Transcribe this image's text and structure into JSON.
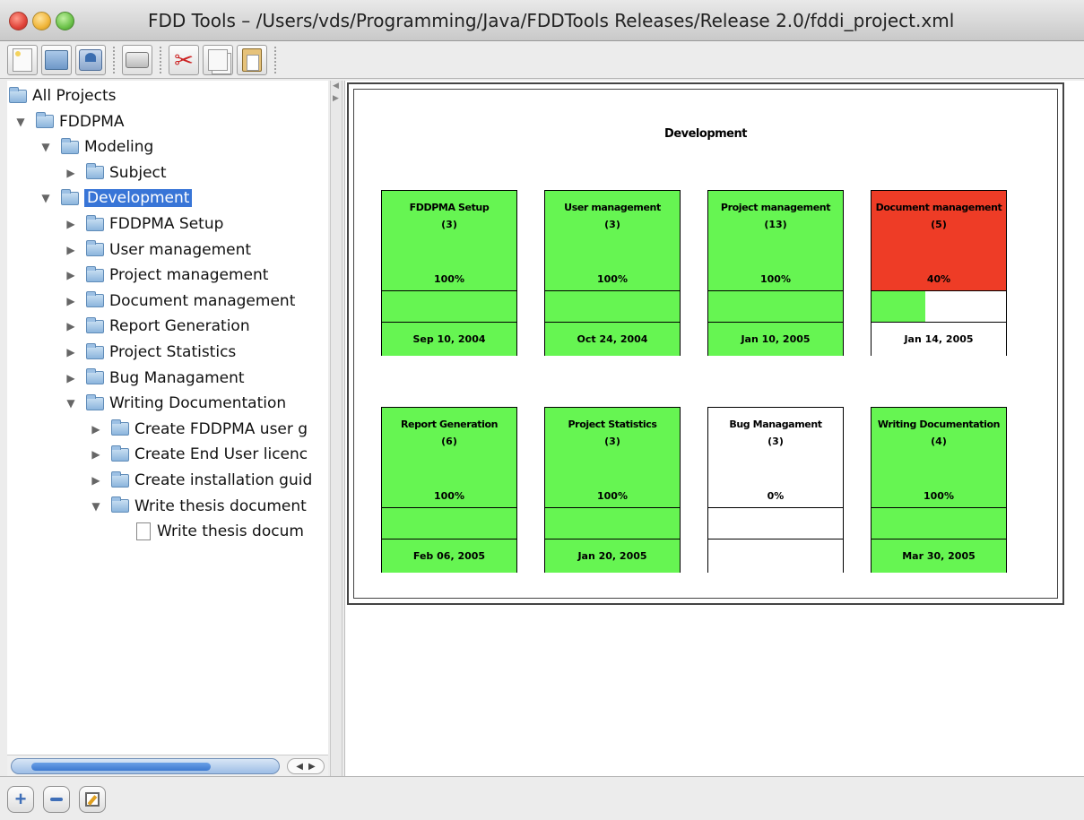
{
  "window": {
    "title": "FDD Tools – /Users/vds/Programming/Java/FDDTools Releases/Release 2.0/fddi_project.xml"
  },
  "toolbar": {
    "buttons": [
      "new-document-icon",
      "open-icon",
      "save-icon",
      "print-icon",
      "cut-icon",
      "copy-icon",
      "paste-icon"
    ]
  },
  "tree": {
    "items": [
      {
        "label": "All Projects",
        "depth": 0,
        "state": "none",
        "icon": "folder-icon"
      },
      {
        "label": "FDDPMA",
        "depth": 0,
        "state": "expanded",
        "icon": "folder-icon"
      },
      {
        "label": "Modeling",
        "depth": 1,
        "state": "expanded",
        "icon": "folder-icon"
      },
      {
        "label": "Subject",
        "depth": 2,
        "state": "collapsed",
        "icon": "folder-icon"
      },
      {
        "label": "Development",
        "depth": 1,
        "state": "expanded",
        "icon": "folder-icon",
        "selected": true
      },
      {
        "label": "FDDPMA Setup",
        "depth": 2,
        "state": "collapsed",
        "icon": "folder-icon"
      },
      {
        "label": "User management",
        "depth": 2,
        "state": "collapsed",
        "icon": "folder-icon"
      },
      {
        "label": "Project management",
        "depth": 2,
        "state": "collapsed",
        "icon": "folder-icon"
      },
      {
        "label": "Document management",
        "depth": 2,
        "state": "collapsed",
        "icon": "folder-icon"
      },
      {
        "label": "Report Generation",
        "depth": 2,
        "state": "collapsed",
        "icon": "folder-icon"
      },
      {
        "label": "Project Statistics",
        "depth": 2,
        "state": "collapsed",
        "icon": "folder-icon"
      },
      {
        "label": "Bug Managament",
        "depth": 2,
        "state": "collapsed",
        "icon": "folder-icon"
      },
      {
        "label": "Writing Documentation",
        "depth": 2,
        "state": "expanded",
        "icon": "folder-icon"
      },
      {
        "label": "Create FDDPMA user g",
        "depth": 3,
        "state": "collapsed",
        "icon": "folder-icon"
      },
      {
        "label": "Create End User licenc",
        "depth": 3,
        "state": "collapsed",
        "icon": "folder-icon"
      },
      {
        "label": "Create installation guid",
        "depth": 3,
        "state": "collapsed",
        "icon": "folder-icon"
      },
      {
        "label": "Write thesis document",
        "depth": 3,
        "state": "expanded",
        "icon": "folder-icon"
      },
      {
        "label": "Write thesis docum",
        "depth": 4,
        "state": "none",
        "icon": "document-icon"
      }
    ]
  },
  "diagram": {
    "title": "Development",
    "cards": [
      {
        "name": "FDDPMA Setup",
        "count": "(3)",
        "percent": "100%",
        "progress": 1.0,
        "date": "Sep 10, 2004",
        "status": "complete"
      },
      {
        "name": "User management",
        "count": "(3)",
        "percent": "100%",
        "progress": 1.0,
        "date": "Oct 24, 2004",
        "status": "complete"
      },
      {
        "name": "Project management",
        "count": "(13)",
        "percent": "100%",
        "progress": 1.0,
        "date": "Jan 10, 2005",
        "status": "complete"
      },
      {
        "name": "Document management",
        "count": "(5)",
        "percent": "40%",
        "progress": 0.4,
        "date": "Jan 14, 2005",
        "status": "late"
      },
      {
        "name": "Report Generation",
        "count": "(6)",
        "percent": "100%",
        "progress": 1.0,
        "date": "Feb 06, 2005",
        "status": "complete"
      },
      {
        "name": "Project Statistics",
        "count": "(3)",
        "percent": "100%",
        "progress": 1.0,
        "date": "Jan 20, 2005",
        "status": "complete"
      },
      {
        "name": "Bug Managament",
        "count": "(3)",
        "percent": "0%",
        "progress": 0.0,
        "date": "",
        "status": "not-started"
      },
      {
        "name": "Writing Documentation",
        "count": "(4)",
        "percent": "100%",
        "progress": 1.0,
        "date": "Mar 30, 2005",
        "status": "complete"
      }
    ]
  },
  "colors": {
    "complete": "#66f552",
    "late": "#ee3c26",
    "not_started": "#ffffff",
    "progress_fill": "#66f552",
    "selection": "#3875d7"
  },
  "bottombar": {
    "buttons": [
      "add-icon",
      "remove-icon",
      "edit-icon"
    ]
  }
}
